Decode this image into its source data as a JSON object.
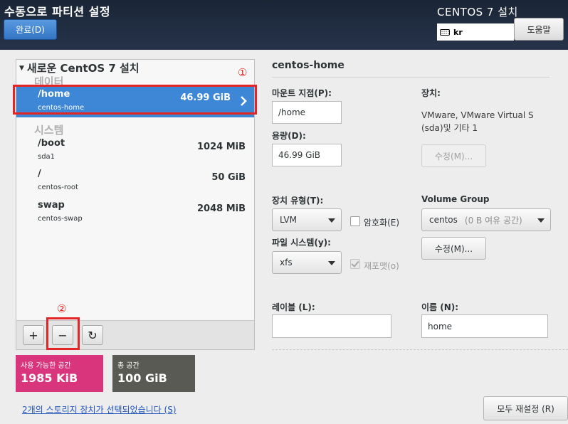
{
  "header": {
    "title": "수동으로 파티션 설정",
    "done_label": "완료(D)",
    "product": "CENTOS 7 설치",
    "keyboard": "kr",
    "help_label": "도움말"
  },
  "tree": {
    "install_label": "새로운 CentOS 7 설치",
    "data_section": "데이터",
    "system_section": "시스템",
    "partitions": [
      {
        "mount": "/home",
        "device": "centos-home",
        "size": "46.99 GiB",
        "selected": true
      },
      {
        "mount": "/boot",
        "device": "sda1",
        "size": "1024 MiB",
        "selected": false
      },
      {
        "mount": "/",
        "device": "centos-root",
        "size": "50 GiB",
        "selected": false
      },
      {
        "mount": "swap",
        "device": "centos-swap",
        "size": "2048 MiB",
        "selected": false
      }
    ],
    "toolbar": [
      {
        "name": "add-partition-button",
        "glyph": "+"
      },
      {
        "name": "remove-partition-button",
        "glyph": "−"
      },
      {
        "name": "refresh-button",
        "glyph": "↻"
      }
    ]
  },
  "annotations": {
    "one": "①",
    "two": "②"
  },
  "space": {
    "available_label": "사용 가능한 공간",
    "available_value": "1985 KiB",
    "available_color": "#d8357d",
    "total_label": "총 공간",
    "total_value": "100 GiB",
    "total_color": "#5a5a55"
  },
  "storage_link": "2개의 스토리지 장치가 선택되었습니다 (S)",
  "detail": {
    "title": "centos-home",
    "mount_label": "마운트 지점(P):",
    "mount_value": "/home",
    "capacity_label": "용량(D):",
    "capacity_value": "46.99 GiB",
    "device_label": "장치:",
    "device_line1": "VMware, VMware Virtual S",
    "device_line2": "(sda)및 기타 1",
    "device_modify": "수정(M)...",
    "device_type_label": "장치 유형(T):",
    "device_type_value": "LVM",
    "encrypt_label": "암호화(E)",
    "fs_label": "파일 시스템(y):",
    "fs_value": "xfs",
    "reformat_label": "재포맷(o)",
    "vg_label": "Volume Group",
    "vg_value": "centos",
    "vg_hint": "(0 B 여유 공간)",
    "vg_modify": "수정(M)...",
    "label_label": "레이블 (L):",
    "label_value": "",
    "name_label": "이름 (N):",
    "name_value": "home"
  },
  "reset_label": "모두 재설정 (R)"
}
